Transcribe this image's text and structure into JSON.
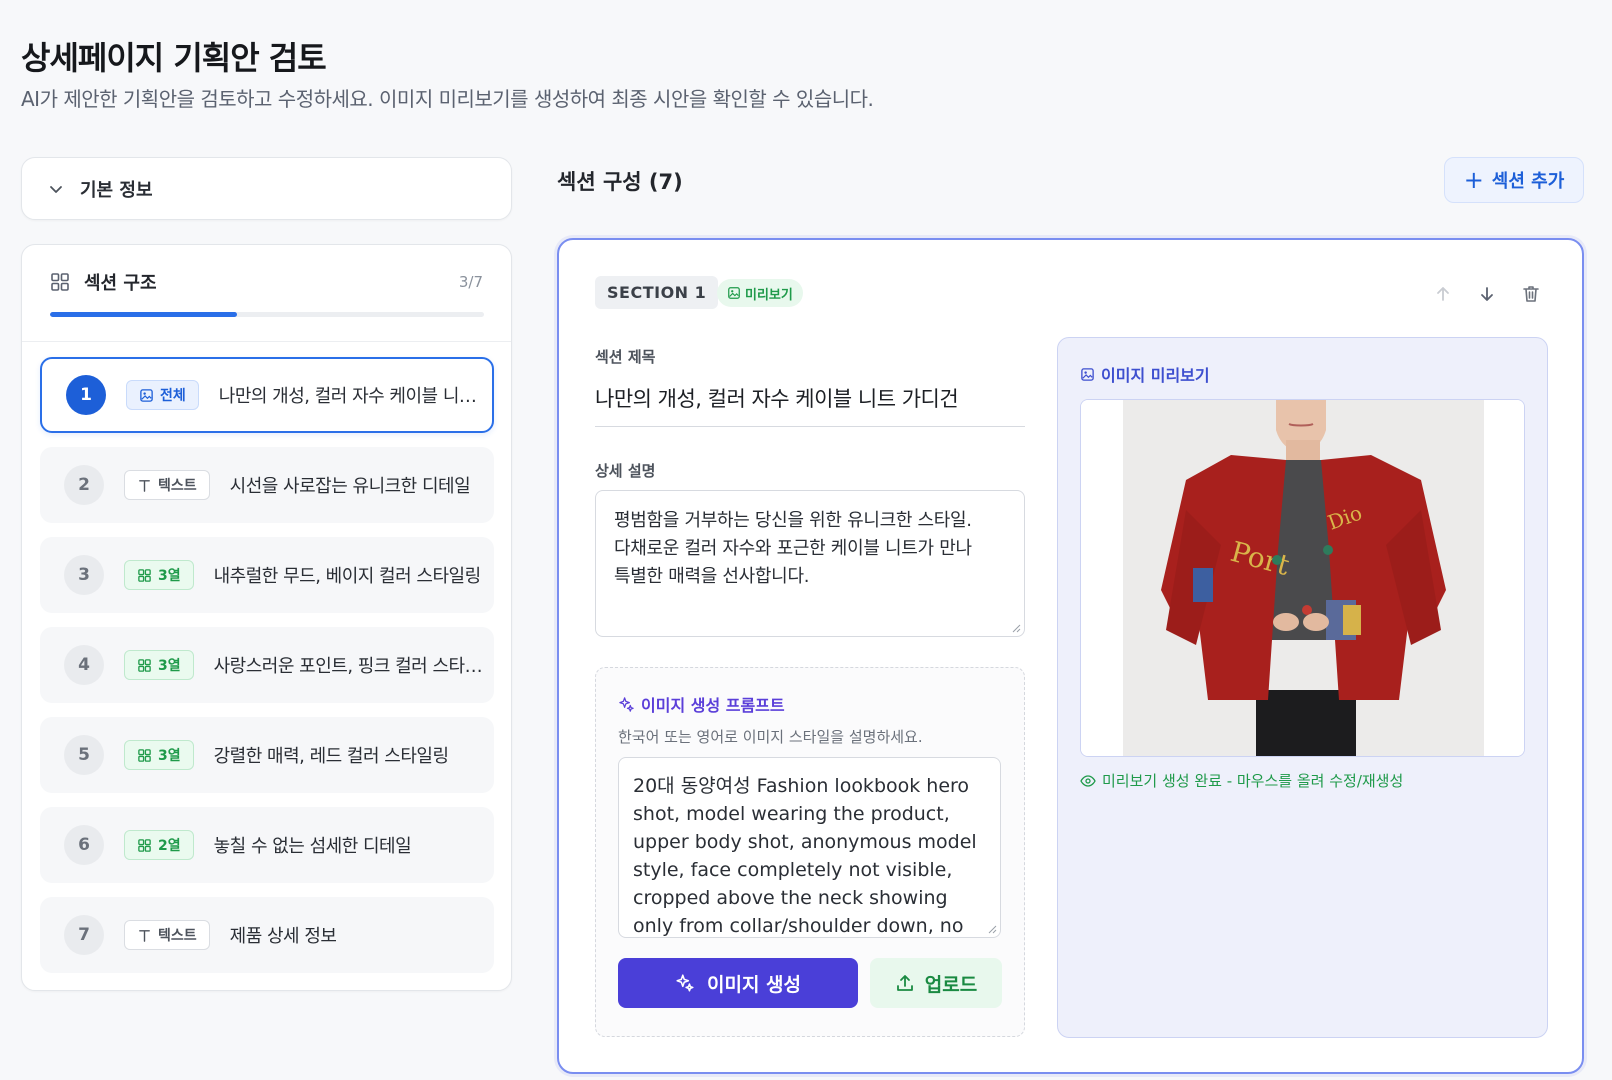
{
  "page": {
    "title": "상세페이지 기획안 검토",
    "subtitle": "AI가 제안한 기획안을 검토하고 수정하세요. 이미지 미리보기를 생성하여 최종 시안을 확인할 수 있습니다."
  },
  "basic_info": {
    "label": "기본 정보",
    "icon": "chevron-down-icon"
  },
  "structure": {
    "label": "섹션 구조",
    "count": "3/7",
    "progress": 0.43,
    "items": [
      {
        "num": "1",
        "badge": "전체",
        "badge_style": "blue",
        "badge_icon": "image-icon",
        "title": "나만의 개성, 컬러 자수 케이블 니트 가디건",
        "active": true
      },
      {
        "num": "2",
        "badge": "텍스트",
        "badge_style": "gray",
        "badge_icon": "text-icon",
        "title": "시선을 사로잡는 유니크한 디테일"
      },
      {
        "num": "3",
        "badge": "3열",
        "badge_style": "green",
        "badge_icon": "grid-icon",
        "title": "내추럴한 무드, 베이지 컬러 스타일링"
      },
      {
        "num": "4",
        "badge": "3열",
        "badge_style": "green",
        "badge_icon": "grid-icon",
        "title": "사랑스러운 포인트, 핑크 컬러 스타일링"
      },
      {
        "num": "5",
        "badge": "3열",
        "badge_style": "green",
        "badge_icon": "grid-icon",
        "title": "강렬한 매력, 레드 컬러 스타일링"
      },
      {
        "num": "6",
        "badge": "2열",
        "badge_style": "green",
        "badge_icon": "grid-icon",
        "title": "놓칠 수 없는 섬세한 디테일"
      },
      {
        "num": "7",
        "badge": "텍스트",
        "badge_style": "gray",
        "badge_icon": "text-icon",
        "title": "제품 상세 정보"
      }
    ]
  },
  "sections_panel": {
    "heading": "섹션 구성 (7)",
    "add_button": "섹션 추가"
  },
  "editor": {
    "section_tag": "SECTION 1",
    "preview_tag": "미리보기",
    "title_label": "섹션 제목",
    "title_value": "나만의 개성, 컬러 자수 케이블 니트 가디건",
    "desc_label": "상세 설명",
    "desc_lines": [
      "평범함을 거부하는 당신을 위한 유니크한 스타일.",
      "다채로운 컬러 자수와 포근한 케이블 니트가 만나",
      "특별한 매력을 선사합니다."
    ],
    "prompt_label": "이미지 생성 프롬프트",
    "prompt_help": "한국어 또는 영어로 이미지 스타일을 설명하세요.",
    "prompt_value": "20대 동양여성 Fashion lookbook hero shot, model wearing the product, upper body shot, anonymous model style, face completely not visible, cropped above the neck showing only from collar/shoulder down, no chin",
    "generate_button": "이미지 생성",
    "upload_button": "업로드",
    "preview_label": "이미지 미리보기",
    "preview_status": "미리보기 생성 완료 - 마우스를 올려 수정/재생성"
  },
  "colors": {
    "accent": "#1d5fd8",
    "purple": "#4a3fd8",
    "green": "#1f9a4a",
    "cardigan_red": "#a8201d"
  }
}
